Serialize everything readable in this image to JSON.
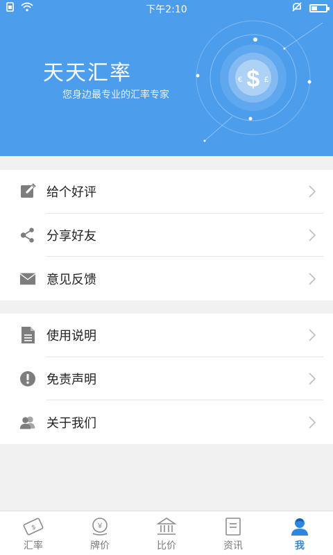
{
  "status_bar": {
    "time": "下午2:10"
  },
  "header": {
    "title": "天天汇率",
    "subtitle": "您身边最专业的汇率专家"
  },
  "menu_group_1": [
    {
      "label": "给个好评",
      "icon": "edit-icon"
    },
    {
      "label": "分享好友",
      "icon": "share-icon"
    },
    {
      "label": "意见反馈",
      "icon": "mail-icon"
    }
  ],
  "menu_group_2": [
    {
      "label": "使用说明",
      "icon": "document-icon"
    },
    {
      "label": "免责声明",
      "icon": "alert-icon"
    },
    {
      "label": "关于我们",
      "icon": "people-icon"
    }
  ],
  "tabbar": [
    {
      "label": "汇率",
      "icon": "exchange-icon",
      "active": false
    },
    {
      "label": "牌价",
      "icon": "yen-coin-icon",
      "active": false
    },
    {
      "label": "比价",
      "icon": "bank-icon",
      "active": false
    },
    {
      "label": "资讯",
      "icon": "news-icon",
      "active": false
    },
    {
      "label": "我",
      "icon": "user-icon",
      "active": true
    }
  ],
  "colors": {
    "brand_blue": "#4d9ded",
    "active_tab": "#2e86de",
    "icon_gray": "#7d7d7d"
  }
}
